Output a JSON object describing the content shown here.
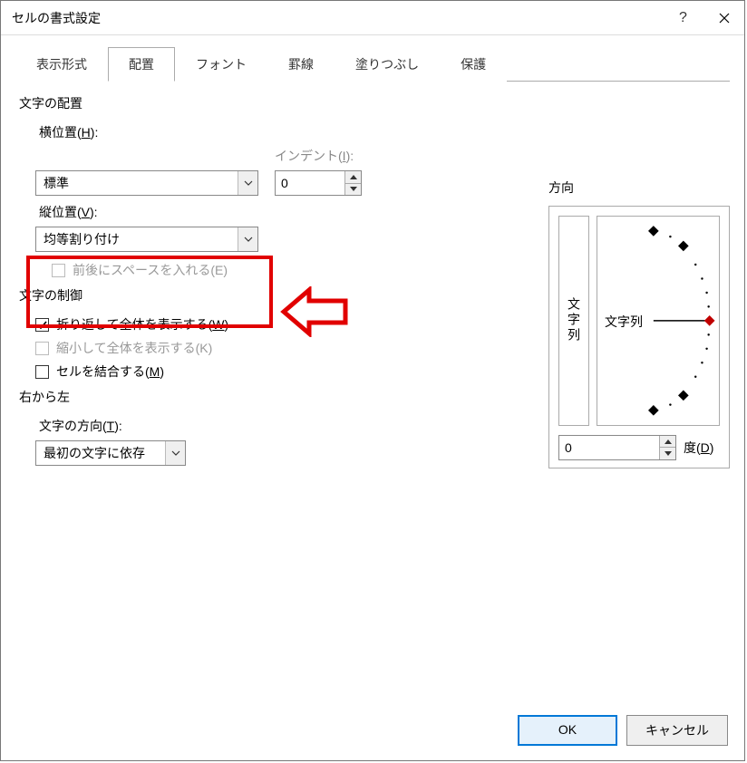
{
  "title": "セルの書式設定",
  "tabs": [
    "表示形式",
    "配置",
    "フォント",
    "罫線",
    "塗りつぶし",
    "保護"
  ],
  "active_tab_index": 1,
  "section_text_align": "文字の配置",
  "horizontal_label": "横位置(H):",
  "horizontal_underline": "H",
  "horizontal_value": "標準",
  "indent_label": "インデント(I):",
  "indent_underline": "I",
  "indent_value": "0",
  "vertical_label": "縦位置(V):",
  "vertical_underline": "V",
  "vertical_value": "均等割り付け",
  "space_check_label": "前後にスペースを入れる(E)",
  "section_text_control": "文字の制御",
  "wrap_check_label": "折り返して全体を表示する(W)",
  "wrap_underline": "W",
  "shrink_check_label": "縮小して全体を表示する(K)",
  "merge_check_label": "セルを結合する(M)",
  "merge_underline": "M",
  "section_rtl": "右から左",
  "text_direction_label": "文字の方向(T):",
  "text_direction_underline": "T",
  "text_direction_value": "最初の文字に依存",
  "orientation_title": "方向",
  "orientation_vertical_text": "文字列",
  "orientation_center_text": "文字列",
  "degrees_value": "0",
  "degrees_label": "度(D)",
  "degrees_underline": "D",
  "ok_label": "OK",
  "cancel_label": "キャンセル"
}
